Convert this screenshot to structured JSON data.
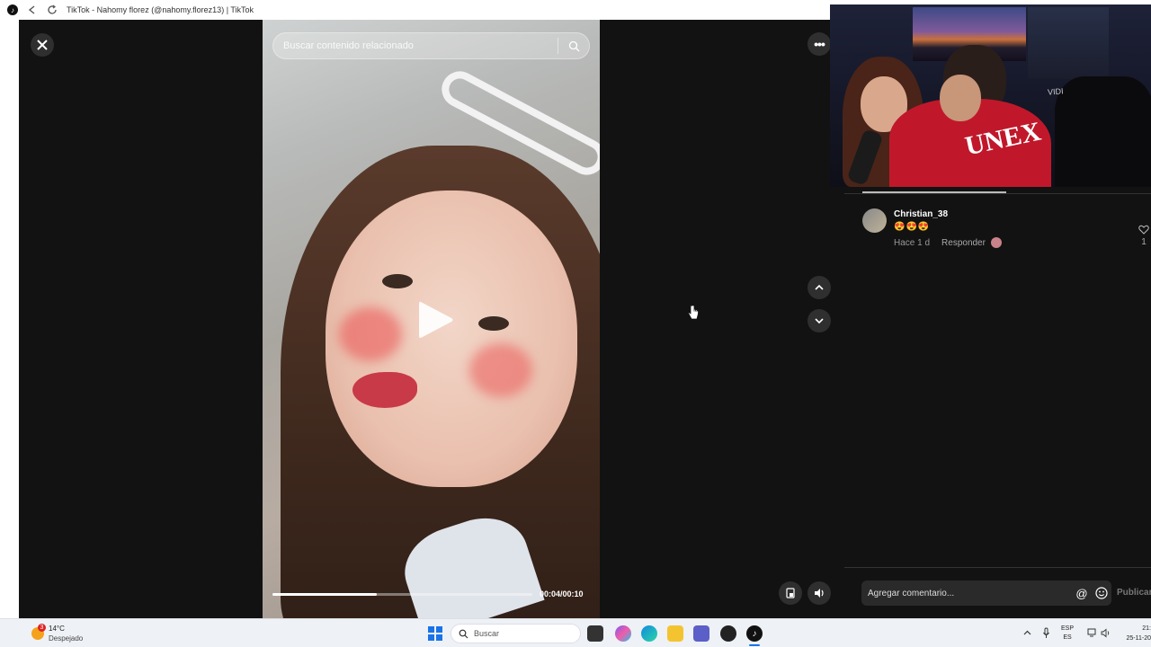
{
  "window": {
    "title": "TikTok - Nahomy florez (@nahomy.florez13) | TikTok"
  },
  "video": {
    "search_placeholder": "Buscar contenido relacionado",
    "time": "00:04/00:10",
    "progress_fraction": 0.4
  },
  "webcam": {
    "hoodie_text": "UNEX",
    "background_text": "VIDI"
  },
  "comment": {
    "username": "Christian_38",
    "emojis": "😍😍😍",
    "time_ago": "Hace 1 d",
    "reply_label": "Responder",
    "like_count": "1"
  },
  "comment_input": {
    "placeholder": "Agregar comentario...",
    "mention_icon": "@",
    "publish_label": "Publicar"
  },
  "taskbar": {
    "weather_badge": "3",
    "temperature": "14°C",
    "condition": "Despejado",
    "search_label": "Buscar",
    "lang_primary": "ESP",
    "lang_secondary": "ES",
    "clock_time": "21:",
    "clock_date": "25-11-20"
  },
  "colors": {
    "accent_blue": "#1a73e8",
    "background_dark": "#121212",
    "hoodie_red": "#c0182a"
  },
  "icons": [
    "tiktok-icon",
    "back-icon",
    "refresh-icon",
    "close-icon",
    "search-icon",
    "play-icon",
    "more-icon",
    "chevron-up-icon",
    "chevron-down-icon",
    "pip-icon",
    "volume-icon",
    "heart-icon",
    "emoji-icon",
    "windows-start-icon",
    "hand-cursor-icon"
  ]
}
